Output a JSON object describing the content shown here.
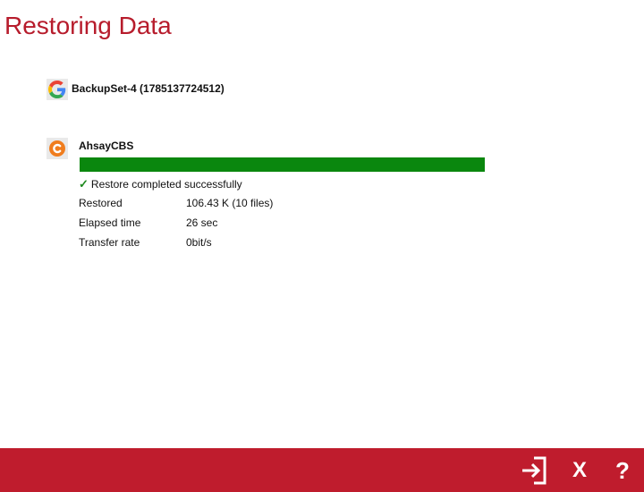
{
  "page": {
    "title": "Restoring Data"
  },
  "backup_set": {
    "icon": "google-g-icon",
    "label": "BackupSet-4 (1785137724512)"
  },
  "destination": {
    "icon": "ahsay-cbs-icon",
    "name": "AhsayCBS",
    "progress": 1.0,
    "status": "Restore completed successfully",
    "stats": [
      {
        "label": "Restored",
        "value": "106.43 K (10 files)"
      },
      {
        "label": "Elapsed time",
        "value": "26 sec"
      },
      {
        "label": "Transfer rate",
        "value": "0bit/s"
      }
    ]
  },
  "footer": {
    "buttons": [
      {
        "icon": "exit-icon"
      },
      {
        "icon": "close-icon"
      },
      {
        "icon": "help-icon"
      }
    ]
  },
  "colors": {
    "accent": "#bf1c2d",
    "title": "#b71c2c",
    "progress": "#0a870e",
    "success": "#1f8a1f"
  }
}
